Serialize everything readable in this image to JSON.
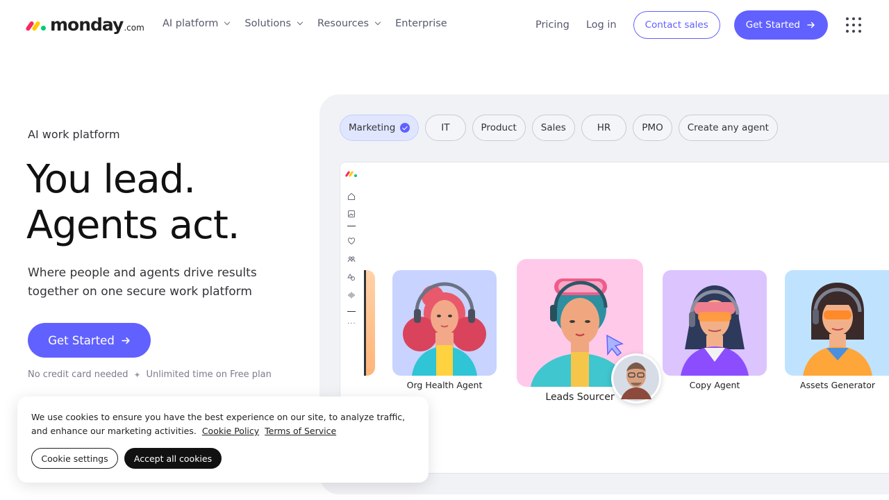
{
  "brand": {
    "name": "monday",
    "suffix": ".com"
  },
  "nav": {
    "items": [
      {
        "label": "AI platform",
        "dropdown": true
      },
      {
        "label": "Solutions",
        "dropdown": true
      },
      {
        "label": "Resources",
        "dropdown": true
      },
      {
        "label": "Enterprise",
        "dropdown": false
      }
    ],
    "pricing": "Pricing",
    "login": "Log in",
    "contact": "Contact sales",
    "get_started": "Get Started"
  },
  "hero": {
    "eyebrow": "AI work platform",
    "headline_line1": "You lead.",
    "headline_line2": "Agents act.",
    "subtext": "Where people and agents drive results together on one secure work platform",
    "cta": "Get Started",
    "fine_1": "No credit card needed",
    "fine_sep": "✦",
    "fine_2": "Unlimited time on Free plan"
  },
  "tabs": [
    {
      "label": "Marketing",
      "selected": true
    },
    {
      "label": "IT",
      "selected": false
    },
    {
      "label": "Product",
      "selected": false
    },
    {
      "label": "Sales",
      "selected": false
    },
    {
      "label": "HR",
      "selected": false
    },
    {
      "label": "PMO",
      "selected": false
    },
    {
      "label": "Create any agent",
      "selected": false
    }
  ],
  "agents": [
    {
      "name": "Org Health Agent"
    },
    {
      "name": "Leads Sourcer"
    },
    {
      "name": "Copy Agent"
    },
    {
      "name": "Assets Generator"
    }
  ],
  "cookie": {
    "text": "We use cookies to ensure you have the best experience on our site, to analyze traffic, and enhance our marketing activities.",
    "policy_link": "Cookie Policy",
    "terms_link": "Terms of Service",
    "settings": "Cookie settings",
    "accept": "Accept all cookies"
  },
  "colors": {
    "accent": "#6161ff",
    "panel": "#f1f2f5"
  }
}
